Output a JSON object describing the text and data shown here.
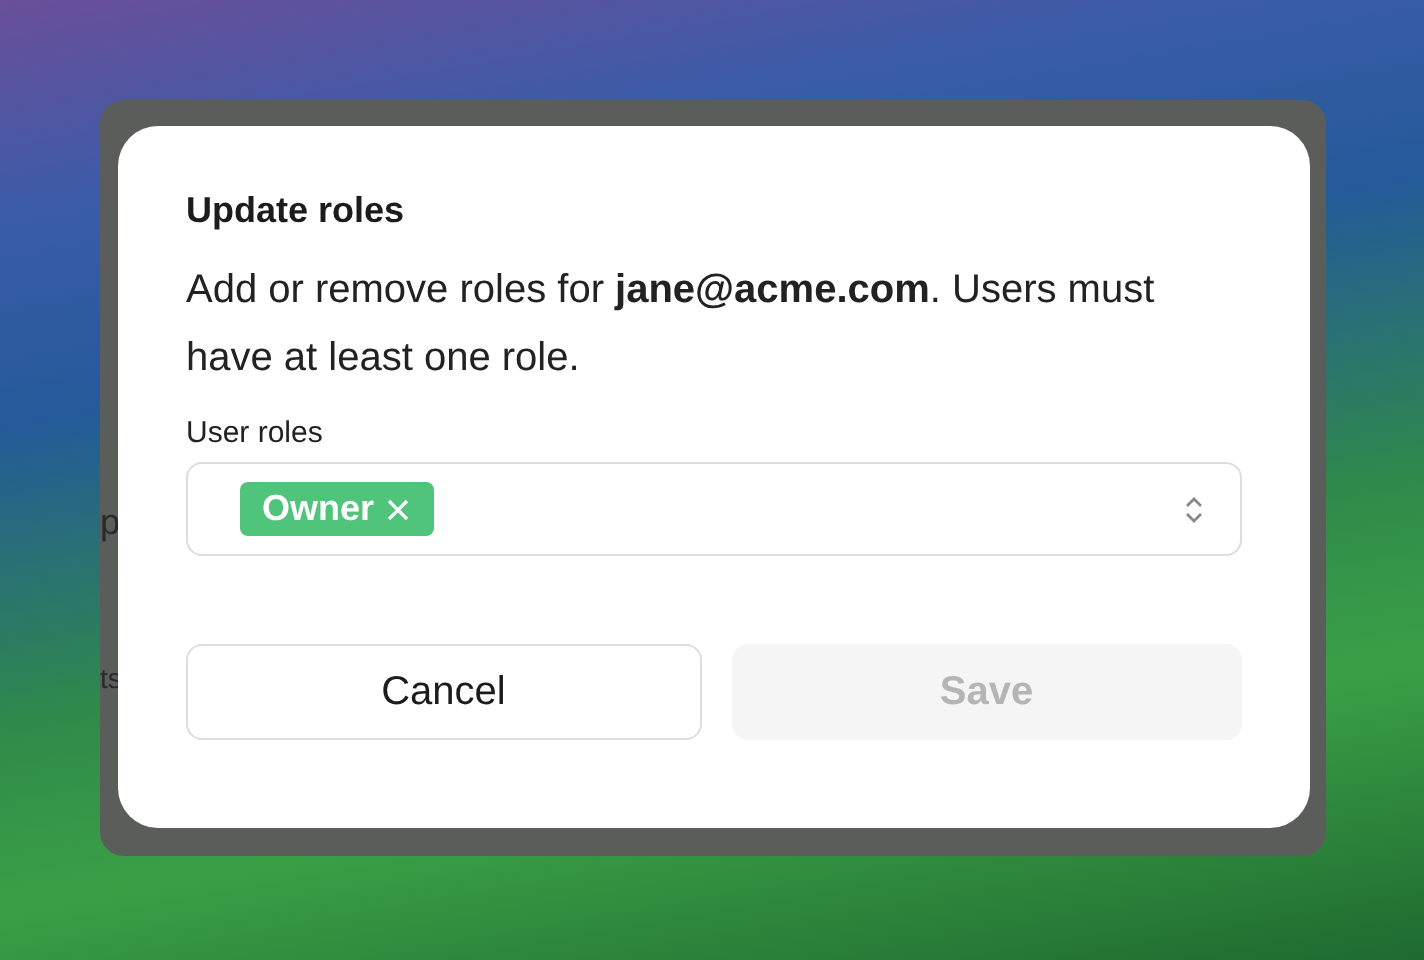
{
  "background_window": {
    "fragments": [
      "p",
      "ts"
    ]
  },
  "dialog": {
    "title": "Update roles",
    "description": "Add or remove roles for **jane@acme.com**. Users must have at least one role.",
    "field": {
      "label": "User roles",
      "chips": [
        {
          "label": "Owner",
          "color": "#4fc47a"
        }
      ]
    },
    "buttons": [
      {
        "label": "Cancel",
        "kind": "secondary",
        "disabled": false
      },
      {
        "label": "Save",
        "kind": "primary",
        "disabled": true
      }
    ]
  }
}
